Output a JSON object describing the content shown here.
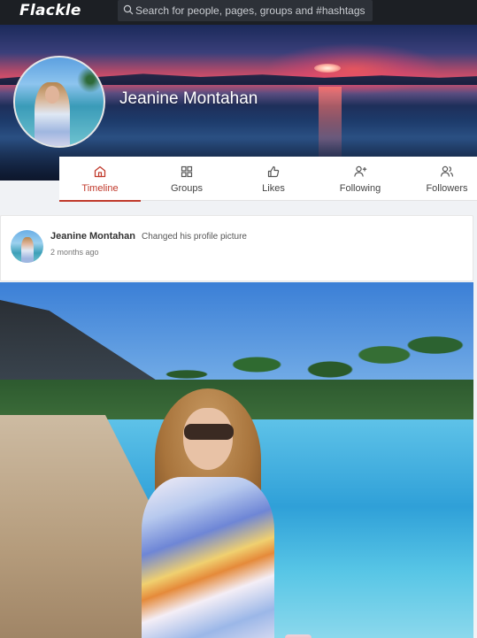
{
  "app": {
    "logo": "Flackle"
  },
  "search": {
    "placeholder": "Search for people, pages, groups and #hashtags",
    "icon": "search-icon"
  },
  "profile": {
    "name": "Jeanine Montahan"
  },
  "tabs": [
    {
      "label": "Timeline",
      "icon": "home-icon",
      "active": true
    },
    {
      "label": "Groups",
      "icon": "grid-icon",
      "active": false
    },
    {
      "label": "Likes",
      "icon": "thumbs-up-icon",
      "active": false
    },
    {
      "label": "Following",
      "icon": "user-plus-icon",
      "active": false
    },
    {
      "label": "Followers",
      "icon": "users-icon",
      "active": false
    }
  ],
  "post": {
    "author": "Jeanine Montahan",
    "action": "Changed his profile picture",
    "time": "2 months ago"
  },
  "colors": {
    "accent": "#c0392b",
    "topbar": "#1c1f24"
  }
}
